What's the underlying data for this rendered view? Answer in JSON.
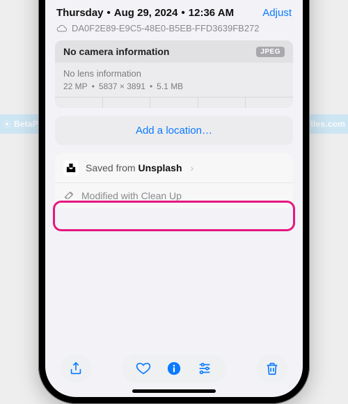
{
  "header": {
    "weekday": "Thursday",
    "date": "Aug 29, 2024",
    "time": "12:36 AM",
    "adjust_label": "Adjust"
  },
  "file": {
    "name": "DA0F2E89-E9C5-48E0-B5EB-FFD3639FB272"
  },
  "camera": {
    "no_camera": "No camera information",
    "format_badge": "JPEG",
    "no_lens": "No lens information",
    "megapixels": "22 MP",
    "dimensions": "5837 × 3891",
    "filesize": "5.1 MB"
  },
  "location": {
    "add_label": "Add a location…"
  },
  "source": {
    "prefix": "Saved from ",
    "name": "Unsplash"
  },
  "modified": {
    "label": "Modified with Clean Up"
  },
  "watermark": {
    "text": "BetaProfiles.com"
  },
  "colors": {
    "accent": "#0a7aff",
    "highlight": "#e6177e"
  }
}
